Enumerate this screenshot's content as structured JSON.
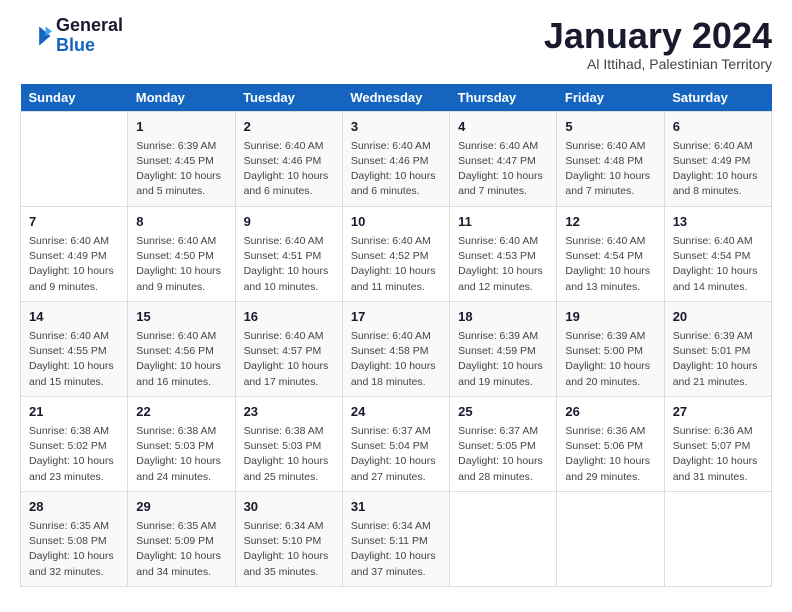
{
  "logo": {
    "general": "General",
    "blue": "Blue"
  },
  "header": {
    "month": "January 2024",
    "location": "Al Ittihad, Palestinian Territory"
  },
  "days_of_week": [
    "Sunday",
    "Monday",
    "Tuesday",
    "Wednesday",
    "Thursday",
    "Friday",
    "Saturday"
  ],
  "weeks": [
    [
      {
        "day": "",
        "sunrise": "",
        "sunset": "",
        "daylight": ""
      },
      {
        "day": "1",
        "sunrise": "Sunrise: 6:39 AM",
        "sunset": "Sunset: 4:45 PM",
        "daylight": "Daylight: 10 hours and 5 minutes."
      },
      {
        "day": "2",
        "sunrise": "Sunrise: 6:40 AM",
        "sunset": "Sunset: 4:46 PM",
        "daylight": "Daylight: 10 hours and 6 minutes."
      },
      {
        "day": "3",
        "sunrise": "Sunrise: 6:40 AM",
        "sunset": "Sunset: 4:46 PM",
        "daylight": "Daylight: 10 hours and 6 minutes."
      },
      {
        "day": "4",
        "sunrise": "Sunrise: 6:40 AM",
        "sunset": "Sunset: 4:47 PM",
        "daylight": "Daylight: 10 hours and 7 minutes."
      },
      {
        "day": "5",
        "sunrise": "Sunrise: 6:40 AM",
        "sunset": "Sunset: 4:48 PM",
        "daylight": "Daylight: 10 hours and 7 minutes."
      },
      {
        "day": "6",
        "sunrise": "Sunrise: 6:40 AM",
        "sunset": "Sunset: 4:49 PM",
        "daylight": "Daylight: 10 hours and 8 minutes."
      }
    ],
    [
      {
        "day": "7",
        "sunrise": "Sunrise: 6:40 AM",
        "sunset": "Sunset: 4:49 PM",
        "daylight": "Daylight: 10 hours and 9 minutes."
      },
      {
        "day": "8",
        "sunrise": "Sunrise: 6:40 AM",
        "sunset": "Sunset: 4:50 PM",
        "daylight": "Daylight: 10 hours and 9 minutes."
      },
      {
        "day": "9",
        "sunrise": "Sunrise: 6:40 AM",
        "sunset": "Sunset: 4:51 PM",
        "daylight": "Daylight: 10 hours and 10 minutes."
      },
      {
        "day": "10",
        "sunrise": "Sunrise: 6:40 AM",
        "sunset": "Sunset: 4:52 PM",
        "daylight": "Daylight: 10 hours and 11 minutes."
      },
      {
        "day": "11",
        "sunrise": "Sunrise: 6:40 AM",
        "sunset": "Sunset: 4:53 PM",
        "daylight": "Daylight: 10 hours and 12 minutes."
      },
      {
        "day": "12",
        "sunrise": "Sunrise: 6:40 AM",
        "sunset": "Sunset: 4:54 PM",
        "daylight": "Daylight: 10 hours and 13 minutes."
      },
      {
        "day": "13",
        "sunrise": "Sunrise: 6:40 AM",
        "sunset": "Sunset: 4:54 PM",
        "daylight": "Daylight: 10 hours and 14 minutes."
      }
    ],
    [
      {
        "day": "14",
        "sunrise": "Sunrise: 6:40 AM",
        "sunset": "Sunset: 4:55 PM",
        "daylight": "Daylight: 10 hours and 15 minutes."
      },
      {
        "day": "15",
        "sunrise": "Sunrise: 6:40 AM",
        "sunset": "Sunset: 4:56 PM",
        "daylight": "Daylight: 10 hours and 16 minutes."
      },
      {
        "day": "16",
        "sunrise": "Sunrise: 6:40 AM",
        "sunset": "Sunset: 4:57 PM",
        "daylight": "Daylight: 10 hours and 17 minutes."
      },
      {
        "day": "17",
        "sunrise": "Sunrise: 6:40 AM",
        "sunset": "Sunset: 4:58 PM",
        "daylight": "Daylight: 10 hours and 18 minutes."
      },
      {
        "day": "18",
        "sunrise": "Sunrise: 6:39 AM",
        "sunset": "Sunset: 4:59 PM",
        "daylight": "Daylight: 10 hours and 19 minutes."
      },
      {
        "day": "19",
        "sunrise": "Sunrise: 6:39 AM",
        "sunset": "Sunset: 5:00 PM",
        "daylight": "Daylight: 10 hours and 20 minutes."
      },
      {
        "day": "20",
        "sunrise": "Sunrise: 6:39 AM",
        "sunset": "Sunset: 5:01 PM",
        "daylight": "Daylight: 10 hours and 21 minutes."
      }
    ],
    [
      {
        "day": "21",
        "sunrise": "Sunrise: 6:38 AM",
        "sunset": "Sunset: 5:02 PM",
        "daylight": "Daylight: 10 hours and 23 minutes."
      },
      {
        "day": "22",
        "sunrise": "Sunrise: 6:38 AM",
        "sunset": "Sunset: 5:03 PM",
        "daylight": "Daylight: 10 hours and 24 minutes."
      },
      {
        "day": "23",
        "sunrise": "Sunrise: 6:38 AM",
        "sunset": "Sunset: 5:03 PM",
        "daylight": "Daylight: 10 hours and 25 minutes."
      },
      {
        "day": "24",
        "sunrise": "Sunrise: 6:37 AM",
        "sunset": "Sunset: 5:04 PM",
        "daylight": "Daylight: 10 hours and 27 minutes."
      },
      {
        "day": "25",
        "sunrise": "Sunrise: 6:37 AM",
        "sunset": "Sunset: 5:05 PM",
        "daylight": "Daylight: 10 hours and 28 minutes."
      },
      {
        "day": "26",
        "sunrise": "Sunrise: 6:36 AM",
        "sunset": "Sunset: 5:06 PM",
        "daylight": "Daylight: 10 hours and 29 minutes."
      },
      {
        "day": "27",
        "sunrise": "Sunrise: 6:36 AM",
        "sunset": "Sunset: 5:07 PM",
        "daylight": "Daylight: 10 hours and 31 minutes."
      }
    ],
    [
      {
        "day": "28",
        "sunrise": "Sunrise: 6:35 AM",
        "sunset": "Sunset: 5:08 PM",
        "daylight": "Daylight: 10 hours and 32 minutes."
      },
      {
        "day": "29",
        "sunrise": "Sunrise: 6:35 AM",
        "sunset": "Sunset: 5:09 PM",
        "daylight": "Daylight: 10 hours and 34 minutes."
      },
      {
        "day": "30",
        "sunrise": "Sunrise: 6:34 AM",
        "sunset": "Sunset: 5:10 PM",
        "daylight": "Daylight: 10 hours and 35 minutes."
      },
      {
        "day": "31",
        "sunrise": "Sunrise: 6:34 AM",
        "sunset": "Sunset: 5:11 PM",
        "daylight": "Daylight: 10 hours and 37 minutes."
      },
      {
        "day": "",
        "sunrise": "",
        "sunset": "",
        "daylight": ""
      },
      {
        "day": "",
        "sunrise": "",
        "sunset": "",
        "daylight": ""
      },
      {
        "day": "",
        "sunrise": "",
        "sunset": "",
        "daylight": ""
      }
    ]
  ]
}
